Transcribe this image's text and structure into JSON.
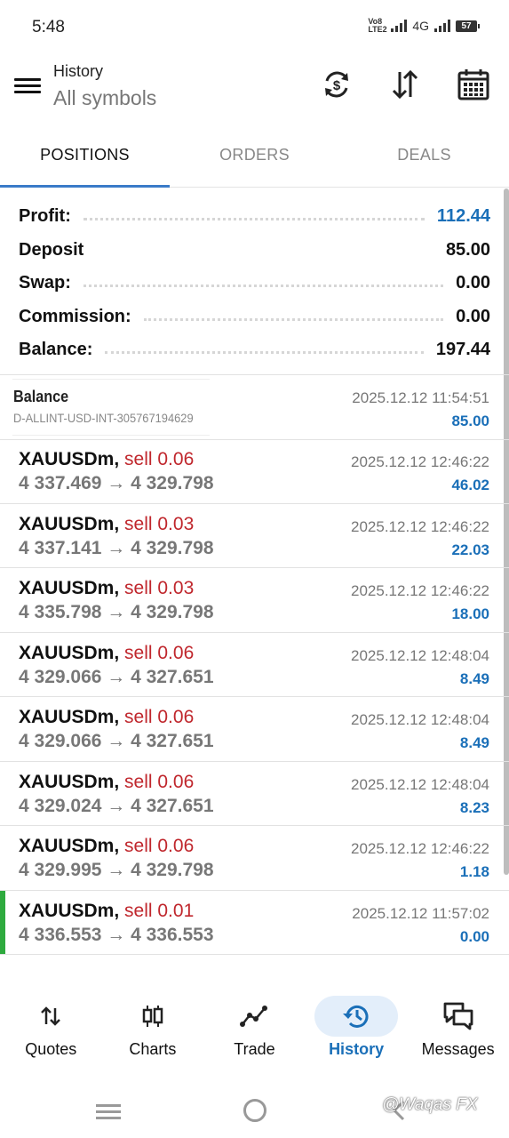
{
  "status_bar": {
    "time": "5:48",
    "volte": "Vo8 LTE2",
    "network": "4G",
    "battery": "57"
  },
  "appbar": {
    "title": "History",
    "subtitle": "All symbols",
    "icons": [
      "currency-exchange-icon",
      "sort-icon",
      "calendar-icon"
    ]
  },
  "tabs": [
    {
      "label": "POSITIONS",
      "active": true
    },
    {
      "label": "ORDERS",
      "active": false
    },
    {
      "label": "DEALS",
      "active": false
    }
  ],
  "summary": {
    "profit_label": "Profit:",
    "profit": "112.44",
    "deposit_label": "Deposit",
    "deposit": "85.00",
    "swap_label": "Swap:",
    "swap": "0.00",
    "commission_label": "Commission:",
    "commission": "0.00",
    "balance_label": "Balance:",
    "balance": "197.44"
  },
  "balance_entry": {
    "name": "Balance",
    "account": "D-ALLINT-USD-INT-305767194629",
    "datetime": "2025.12.12 11:54:51",
    "amount": "85.00"
  },
  "trades": [
    {
      "symbol": "XAUUSDm,",
      "side": "sell 0.06",
      "prices": "4 337.469 → 4 329.798",
      "datetime": "2025.12.12 12:46:22",
      "profit": "46.02"
    },
    {
      "symbol": "XAUUSDm,",
      "side": "sell 0.03",
      "prices": "4 337.141 → 4 329.798",
      "datetime": "2025.12.12 12:46:22",
      "profit": "22.03"
    },
    {
      "symbol": "XAUUSDm,",
      "side": "sell 0.03",
      "prices": "4 335.798 → 4 329.798",
      "datetime": "2025.12.12 12:46:22",
      "profit": "18.00"
    },
    {
      "symbol": "XAUUSDm,",
      "side": "sell 0.06",
      "prices": "4 329.066 → 4 327.651",
      "datetime": "2025.12.12 12:48:04",
      "profit": "8.49"
    },
    {
      "symbol": "XAUUSDm,",
      "side": "sell 0.06",
      "prices": "4 329.066 → 4 327.651",
      "datetime": "2025.12.12 12:48:04",
      "profit": "8.49"
    },
    {
      "symbol": "XAUUSDm,",
      "side": "sell 0.06",
      "prices": "4 329.024 → 4 327.651",
      "datetime": "2025.12.12 12:48:04",
      "profit": "8.23"
    },
    {
      "symbol": "XAUUSDm,",
      "side": "sell 0.06",
      "prices": "4 329.995 → 4 329.798",
      "datetime": "2025.12.12 12:46:22",
      "profit": "1.18"
    },
    {
      "symbol": "XAUUSDm,",
      "side": "sell 0.01",
      "prices": "4 336.553 → 4 336.553",
      "datetime": "2025.12.12 11:57:02",
      "profit": "0.00"
    }
  ],
  "bottom_nav": [
    {
      "label": "Quotes",
      "icon": "quotes-icon",
      "active": false
    },
    {
      "label": "Charts",
      "icon": "charts-icon",
      "active": false
    },
    {
      "label": "Trade",
      "icon": "trade-icon",
      "active": false
    },
    {
      "label": "History",
      "icon": "history-icon",
      "active": true
    },
    {
      "label": "Messages",
      "icon": "messages-icon",
      "active": false
    }
  ],
  "watermark": "@Waqas FX",
  "colors": {
    "accent": "#1a6fb8",
    "sell": "#c0272d",
    "selected_bar": "#2eaa3e",
    "tab_underline": "#3a7bc8"
  }
}
